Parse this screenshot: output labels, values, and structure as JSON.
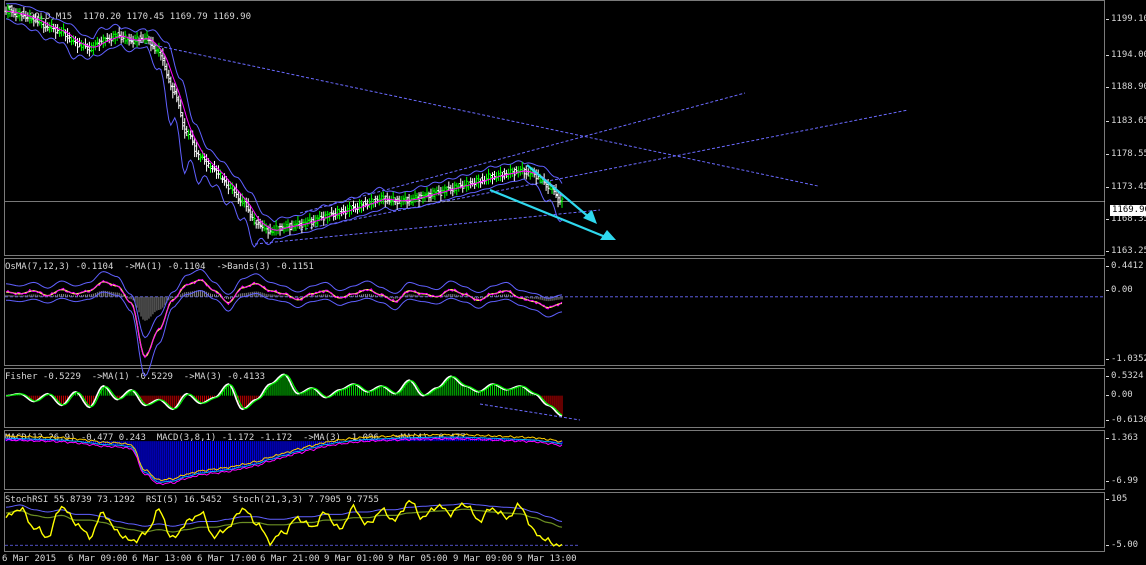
{
  "symbol": {
    "label": "GOLD,M15",
    "ohlc": "1170.20 1170.45 1169.79 1169.90"
  },
  "price_box": "1169.90",
  "colors": {
    "bull_bar": "#00ff00",
    "bear_bar": "#ffffff",
    "ma": "#ff00ff",
    "bands": "#6060ff",
    "trend": "#6a6aff",
    "arrow": "#2fd8ee",
    "osma": "#ffff55",
    "fisher_pos": "#00cc00",
    "fisher_neg": "#cc0000",
    "macd_hist": "#0000ff",
    "stoch_rsi": "#ffff00",
    "stoch": "#6060ff"
  },
  "panes": {
    "osma": {
      "label": "OsMA(7,12,3) -0.1104  ->MA(1) -0.1104  ->Bands(3) -0.1151"
    },
    "fisher": {
      "label": "Fisher -0.5229  ->MA(1) -0.5229  ->MA(3) -0.4133"
    },
    "macd": {
      "label": "MACD(12,26,9) -0.477 0.243  MACD(3,8,1) -1.172 -1.172  ->MA(3) -1.096  ->MA(4) -0.477"
    },
    "stoch": {
      "label": "StochRSI 55.8739 73.1292  RSI(5) 16.5452  Stoch(21,3,3) 7.7905 9.7755"
    }
  },
  "chart_data": [
    {
      "type": "line",
      "title": "GOLD,M15",
      "ylim": [
        1161.5,
        1202.0
      ],
      "y_ticks": [
        "1199.10",
        "1194.00",
        "1188.90",
        "1183.65",
        "1178.55",
        "1173.45",
        "1168.35",
        "1163.25"
      ],
      "y_tick_values": [
        1199.1,
        1194.0,
        1188.9,
        1183.65,
        1178.55,
        1173.45,
        1168.35,
        1163.25
      ],
      "x_ticks": [
        "6 Mar 2015",
        "6 Mar 09:00",
        "6 Mar 13:00",
        "6 Mar 17:00",
        "6 Mar 21:00",
        "9 Mar 01:00",
        "9 Mar 05:00",
        "9 Mar 09:00",
        "9 Mar 13:00"
      ],
      "series": [
        {
          "values": [
            1200.5,
            1200.0,
            1199.2,
            1198.0,
            1197.2,
            1195.4,
            1194.6,
            1195.8,
            1196.6,
            1195.8,
            1196.2,
            1194.0,
            1188.0,
            1181.0,
            1177.0,
            1175.0,
            1172.5,
            1170.0,
            1166.5,
            1165.2,
            1165.8,
            1166.2,
            1166.8,
            1167.6,
            1168.2,
            1168.9,
            1169.6,
            1170.4,
            1170.0,
            1170.2,
            1170.8,
            1171.4,
            1172.0,
            1172.6,
            1173.2,
            1173.9,
            1174.4,
            1174.9,
            1174.3,
            1172.5,
            1169.9
          ]
        }
      ],
      "trendlines": "4",
      "arrows": "2",
      "last_price": 1169.9
    },
    {
      "type": "line",
      "title": "OsMA(7,12,3)",
      "y_ticks": [
        "0.4412",
        "0.00",
        "-1.0352"
      ],
      "y_tick_values": [
        0.4412,
        0.0,
        -1.0352
      ],
      "ylim": [
        -1.12,
        0.58
      ],
      "series": [
        {
          "name": "OsMA",
          "values": [
            0.08,
            0.05,
            0.1,
            0.02,
            0.12,
            0.05,
            0.1,
            0.25,
            0.18,
            -0.1,
            -1.0,
            -0.55,
            -0.05,
            0.2,
            0.28,
            0.1,
            -0.1,
            0.15,
            0.22,
            0.1,
            0.05,
            -0.05,
            0.05,
            0.1,
            -0.02,
            0.05,
            0.12,
            0.03,
            -0.08,
            0.1,
            0.05,
            0.0,
            0.12,
            0.04,
            -0.06,
            0.05,
            0.1,
            -0.02,
            -0.08,
            -0.18,
            -0.11
          ]
        }
      ]
    },
    {
      "type": "line",
      "title": "Fisher",
      "y_ticks": [
        "0.5324",
        "0.00",
        "-0.6136"
      ],
      "y_tick_values": [
        0.5324,
        0.0,
        -0.6136
      ],
      "ylim": [
        -0.78,
        0.66
      ],
      "series": [
        {
          "name": "Fisher",
          "values": [
            0.0,
            0.05,
            -0.15,
            0.05,
            -0.25,
            0.1,
            -0.3,
            0.25,
            -0.1,
            0.15,
            -0.25,
            -0.1,
            -0.35,
            0.05,
            -0.2,
            -0.05,
            0.3,
            -0.35,
            -0.1,
            0.3,
            0.55,
            0.05,
            0.2,
            -0.05,
            0.15,
            0.3,
            0.1,
            0.25,
            0.05,
            0.4,
            0.0,
            0.2,
            0.5,
            0.25,
            0.1,
            0.3,
            0.15,
            0.25,
            0.05,
            -0.25,
            -0.52
          ]
        }
      ]
    },
    {
      "type": "area",
      "title": "MACD(12,26,9)",
      "y_ticks": [
        "1.363",
        "-6.99"
      ],
      "y_tick_values": [
        1.363,
        -6.99
      ],
      "ylim": [
        -8.2,
        1.6
      ],
      "series": [
        {
          "name": "MACD",
          "values": [
            0.5,
            0.45,
            0.35,
            0.3,
            0.2,
            0.0,
            -0.3,
            -0.6,
            -0.7,
            -1.0,
            -5.5,
            -7.2,
            -7.0,
            -6.2,
            -5.6,
            -5.3,
            -5.0,
            -4.5,
            -4.0,
            -3.2,
            -2.5,
            -1.8,
            -1.2,
            -0.6,
            -0.2,
            0.1,
            0.3,
            0.4,
            0.5,
            0.6,
            0.65,
            0.7,
            0.7,
            0.7,
            0.6,
            0.5,
            0.4,
            0.3,
            0.2,
            -0.1,
            -0.48
          ]
        }
      ]
    },
    {
      "type": "line",
      "title": "StochRSI",
      "y_ticks": [
        "105",
        "-5.00"
      ],
      "y_tick_values": [
        105,
        -5
      ],
      "ylim": [
        -8,
        110
      ],
      "series": [
        {
          "name": "StochRSI",
          "values": [
            60,
            80,
            40,
            20,
            85,
            50,
            20,
            70,
            30,
            10,
            25,
            75,
            15,
            50,
            70,
            20,
            40,
            80,
            50,
            10,
            30,
            60,
            40,
            70,
            35,
            80,
            45,
            75,
            55,
            95,
            60,
            85,
            70,
            90,
            55,
            80,
            60,
            85,
            30,
            10,
            0
          ]
        },
        {
          "name": "Stoch(21,3,3)",
          "values": [
            70,
            75,
            65,
            60,
            65,
            55,
            55,
            50,
            40,
            35,
            30,
            35,
            30,
            35,
            40,
            40,
            45,
            50,
            50,
            45,
            45,
            50,
            50,
            55,
            55,
            60,
            60,
            65,
            65,
            70,
            72,
            74,
            75,
            78,
            75,
            72,
            70,
            68,
            60,
            50,
            40
          ]
        }
      ]
    }
  ]
}
